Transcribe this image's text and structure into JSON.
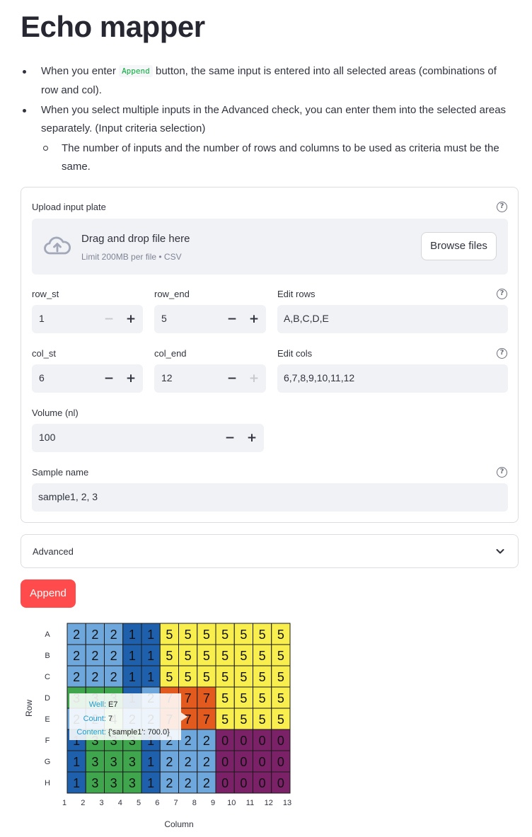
{
  "title": "Echo mapper",
  "bullets": [
    {
      "pre": "When you enter ",
      "code": "Append",
      "post": " button, the same input is entered into all selected areas (combinations of row and col)."
    },
    {
      "text": "When you select multiple inputs in the Advanced check, you can enter them into the selected areas separately. (Input criteria selection)"
    },
    {
      "text": "The number of inputs and the number of rows and columns to be used as criteria must be the same."
    }
  ],
  "upload": {
    "label": "Upload input plate",
    "drag_text": "Drag and drop file here",
    "limit_text": "Limit 200MB per file • CSV",
    "browse_label": "Browse files"
  },
  "fields": {
    "row_st": {
      "label": "row_st",
      "value": "1"
    },
    "row_end": {
      "label": "row_end",
      "value": "5"
    },
    "edit_rows": {
      "label": "Edit rows",
      "value": "A,B,C,D,E"
    },
    "col_st": {
      "label": "col_st",
      "value": "6"
    },
    "col_end": {
      "label": "col_end",
      "value": "12"
    },
    "edit_cols": {
      "label": "Edit cols",
      "value": "6,7,8,9,10,11,12"
    },
    "volume": {
      "label": "Volume (nl)",
      "value": "100"
    },
    "sample_name": {
      "label": "Sample name",
      "value": "sample1, 2, 3"
    }
  },
  "advanced_label": "Advanced",
  "append_label": "Append",
  "icons": {
    "minus": "−",
    "plus": "+",
    "help": "?"
  },
  "chart_data": {
    "type": "heatmap",
    "xlabel": "Column",
    "ylabel": "Row",
    "rows": [
      "A",
      "B",
      "C",
      "D",
      "E",
      "F",
      "G",
      "H"
    ],
    "x_ticks": [
      1,
      2,
      3,
      4,
      5,
      6,
      7,
      8,
      9,
      10,
      11,
      12,
      13
    ],
    "cells": [
      [
        2,
        2,
        2,
        1,
        1,
        5,
        5,
        5,
        5,
        5,
        5,
        5
      ],
      [
        2,
        2,
        2,
        1,
        1,
        5,
        5,
        5,
        5,
        5,
        5,
        5
      ],
      [
        2,
        2,
        2,
        1,
        1,
        5,
        5,
        5,
        5,
        5,
        5,
        5
      ],
      [
        3,
        3,
        3,
        1,
        2,
        7,
        7,
        7,
        5,
        5,
        5,
        5
      ],
      [
        2,
        2,
        4,
        2,
        2,
        7,
        7,
        7,
        5,
        5,
        5,
        5
      ],
      [
        1,
        3,
        3,
        3,
        1,
        2,
        2,
        2,
        0,
        0,
        0,
        0
      ],
      [
        1,
        3,
        3,
        3,
        1,
        2,
        2,
        2,
        0,
        0,
        0,
        0
      ],
      [
        1,
        3,
        3,
        3,
        1,
        2,
        2,
        2,
        0,
        0,
        0,
        0
      ]
    ],
    "value_colors": {
      "0": "#7b2167",
      "1": "#1f60ad",
      "2": "#6ea7dc",
      "3": "#3fa64e",
      "4": "#9fd38a",
      "5": "#f8ef4e",
      "7": "#e35a1e"
    },
    "tooltip": {
      "well_label": "Well:",
      "well": "E7",
      "count_label": "Count:",
      "count": "7",
      "content_label": "Content:",
      "content": "{'sample1': 700.0}"
    }
  }
}
